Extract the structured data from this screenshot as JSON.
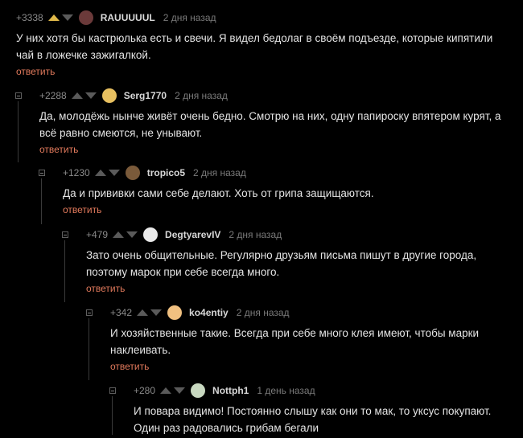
{
  "reply_label": "ответить",
  "accent_colors": {
    "upvoted": "#e0b94a",
    "reply_link": "#e27a5c"
  },
  "comments": [
    {
      "rating": "+3338",
      "upvoted": true,
      "username": "RAUUUUUL",
      "time": "2 дня назад",
      "avatar_color": "#6b3a3a",
      "lines": [
        "У них хотя бы кастрюлька есть и свечи. Я видел бедолаг в своём подъезде, которые  кипятили",
        "чай в ложечке зажигалкой."
      ]
    },
    {
      "rating": "+2288",
      "upvoted": false,
      "username": "Serg1770",
      "time": "2 дня назад",
      "avatar_color": "#e8c060",
      "lines": [
        "Да, молодёжь нынче живёт очень бедно. Смотрю на них, одну папироску впятером курят, а",
        "всё равно смеются, не унывают."
      ]
    },
    {
      "rating": "+1230",
      "upvoted": false,
      "username": "tropico5",
      "time": "2 дня назад",
      "avatar_color": "#7a5a3a",
      "lines": [
        "Да и прививки сами себе делают. Хоть от грипа защищаются."
      ]
    },
    {
      "rating": "+479",
      "upvoted": false,
      "username": "DegtyarevIV",
      "time": "2 дня назад",
      "avatar_color": "#eaeaea",
      "lines": [
        "Зато очень общительные. Регулярно друзьям письма пишут в другие города,",
        "поэтому марок при себе всегда много."
      ]
    },
    {
      "rating": "+342",
      "upvoted": false,
      "username": "ko4entiy",
      "time": "2 дня назад",
      "avatar_color": "#f0c080",
      "lines": [
        "И хозяйственные такие. Всегда при себе много клея имеют, чтобы марки",
        "наклеивать."
      ]
    },
    {
      "rating": "+280",
      "upvoted": false,
      "username": "Nottph1",
      "time": "1 день назад",
      "avatar_color": "#c8d8c0",
      "lines": [
        "И повара видимо! Постоянно слышу как они то мак, то уксус покупают.",
        "Один раз радовались грибам бегали"
      ]
    }
  ]
}
